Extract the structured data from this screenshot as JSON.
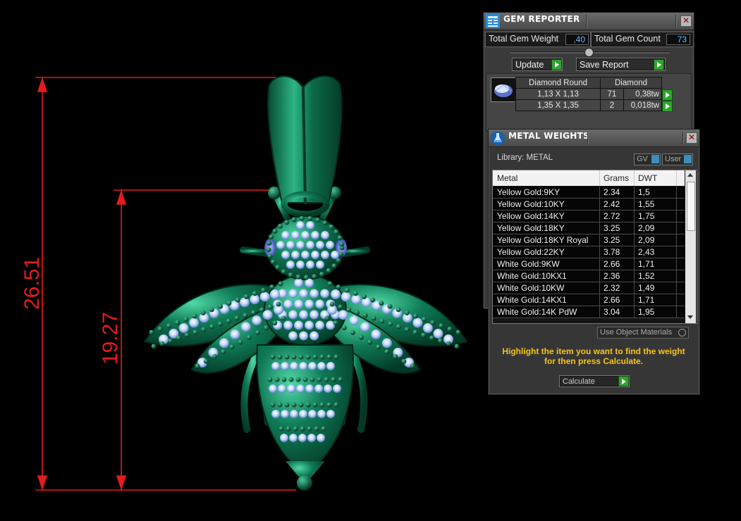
{
  "dimensions": {
    "outer_label": "26.51",
    "inner_label": "19.27",
    "line_color": "#e31b1b"
  },
  "model": {
    "body_color": "#0e6e4f",
    "stone_color": "#cfe3ff"
  },
  "gem_reporter": {
    "title": "GEM REPORTER",
    "icon": "grid-report-icon",
    "total_weight_label": "Total Gem Weight",
    "total_weight_value": ",40",
    "total_count_label": "Total Gem Count",
    "total_count_value": "73",
    "update_label": "Update",
    "save_label": "Save Report",
    "gem_header": {
      "shape": "Diamond Round",
      "material": "Diamond"
    },
    "gem_rows": [
      {
        "size": "1,13 X 1,13",
        "count": "71",
        "weight": "0,38tw"
      },
      {
        "size": "1,35 X 1,35",
        "count": "2",
        "weight": "0,018tw"
      }
    ]
  },
  "metal_weights": {
    "title": "METAL WEIGHTS",
    "icon": "flask-icon",
    "library_label": "Library: METAL",
    "gv_label": "GV",
    "user_label": "User",
    "columns": [
      "Metal",
      "Grams",
      "DWT"
    ],
    "rows": [
      {
        "metal": "Yellow Gold:9KY",
        "grams": "2.34",
        "dwt": "1,5"
      },
      {
        "metal": "Yellow Gold:10KY",
        "grams": "2.42",
        "dwt": "1,55"
      },
      {
        "metal": "Yellow Gold:14KY",
        "grams": "2.72",
        "dwt": "1,75"
      },
      {
        "metal": "Yellow Gold:18KY",
        "grams": "3.25",
        "dwt": "2,09"
      },
      {
        "metal": "Yellow Gold:18KY Royal",
        "grams": "3.25",
        "dwt": "2,09"
      },
      {
        "metal": "Yellow Gold:22KY",
        "grams": "3.78",
        "dwt": "2,43"
      },
      {
        "metal": "White Gold:9KW",
        "grams": "2.66",
        "dwt": "1,71"
      },
      {
        "metal": "White Gold:10KX1",
        "grams": "2.36",
        "dwt": "1,52"
      },
      {
        "metal": "White Gold:10KW",
        "grams": "2.32",
        "dwt": "1,49"
      },
      {
        "metal": "White Gold:14KX1",
        "grams": "2.66",
        "dwt": "1,71"
      },
      {
        "metal": "White Gold:14K PdW",
        "grams": "3.04",
        "dwt": "1,95"
      }
    ],
    "use_object_materials_label": "Use Object Materials",
    "instruction": "Highlight the item you want to find the weight for then press Calculate.",
    "calculate_label": "Calculate"
  }
}
